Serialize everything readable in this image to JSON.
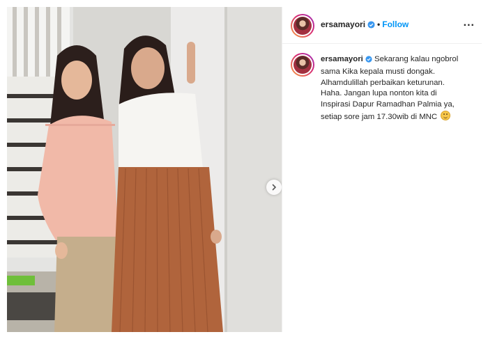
{
  "post": {
    "username": "ersamayori",
    "separator": "•",
    "follow_label": "Follow",
    "more_label": "...",
    "caption_text": "Sekarang kalau ngobrol sama Kika kepala musti dongak. Alhamdulillah perbaikan keturunan. Haha. Jangan lupa nonton kita di Inspirasi Dapur Ramadhan Palmia ya, setiap sore jam 17.30wib di MNC",
    "emoji_icon": "smiling-face-emoji"
  },
  "icons": {
    "verified": "verified-badge-icon",
    "next": "chevron-right-icon",
    "more": "more-options-icon"
  },
  "colors": {
    "accent": "#0095f6",
    "verified": "#3897f0",
    "text": "#262626"
  }
}
